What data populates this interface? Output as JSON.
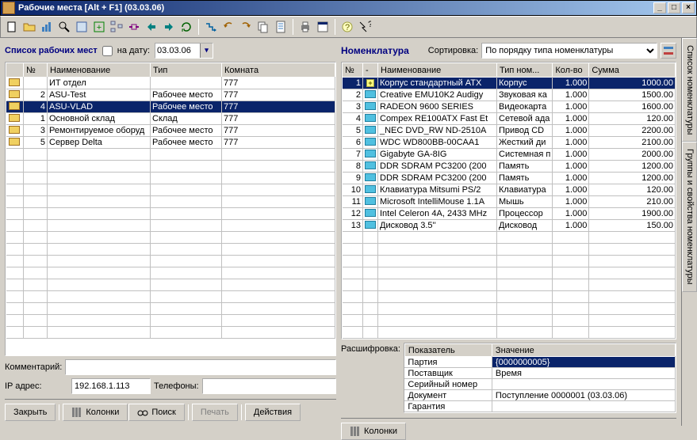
{
  "window": {
    "title": "Рабочие места [Alt + F1] (03.03.06)"
  },
  "left": {
    "heading": "Список рабочих мест",
    "date_label": "на дату:",
    "date_value": "03.03.06",
    "cols": {
      "num": "№",
      "name": "Наименование",
      "type": "Тип",
      "room": "Комната"
    },
    "rows": [
      {
        "num": "",
        "name": "ИТ отдел",
        "type": "",
        "room": "777",
        "selected": false
      },
      {
        "num": "2",
        "name": "ASU-Test",
        "type": "Рабочее место",
        "room": "777",
        "selected": false
      },
      {
        "num": "4",
        "name": "ASU-VLAD",
        "type": "Рабочее место",
        "room": "777",
        "selected": true
      },
      {
        "num": "1",
        "name": "Основной склад",
        "type": "Склад",
        "room": "777",
        "selected": false
      },
      {
        "num": "3",
        "name": "Ремонтируемое оборуд",
        "type": "Рабочее место",
        "room": "777",
        "selected": false
      },
      {
        "num": "5",
        "name": "Сервер Delta",
        "type": "Рабочее место",
        "room": "777",
        "selected": false
      }
    ],
    "comment_label": "Комментарий:",
    "comment_value": "",
    "ip_label": "IP адрес:",
    "ip_value": "192.168.1.113",
    "phones_label": "Телефоны:",
    "phones_value": "",
    "btn_close": "Закрыть",
    "btn_columns": "Колонки",
    "btn_search": "Поиск",
    "btn_print": "Печать",
    "btn_actions": "Действия"
  },
  "right": {
    "heading": "Номенклатура",
    "sort_label": "Сортировка:",
    "sort_value": "По порядку типа номенклатуры",
    "cols": {
      "num": "№",
      "dash": "-",
      "name": "Наименование",
      "type": "Тип ном...",
      "qty": "Кол-во",
      "sum": "Сумма"
    },
    "rows": [
      {
        "num": "1",
        "name": "Корпус стандартный ATX",
        "type": "Корпус",
        "qty": "1.000",
        "sum": "1000.00",
        "selected": true,
        "star": true
      },
      {
        "num": "2",
        "name": "Creative EMU10K2 Audigy",
        "type": "Звуковая ка",
        "qty": "1.000",
        "sum": "1500.00"
      },
      {
        "num": "3",
        "name": "RADEON 9600 SERIES",
        "type": "Видеокарта",
        "qty": "1.000",
        "sum": "1600.00"
      },
      {
        "num": "4",
        "name": "Compex RE100ATX Fast Et",
        "type": "Сетевой ада",
        "qty": "1.000",
        "sum": "120.00"
      },
      {
        "num": "5",
        "name": "_NEC DVD_RW ND-2510A",
        "type": "Привод CD",
        "qty": "1.000",
        "sum": "2200.00"
      },
      {
        "num": "6",
        "name": "WDC WD800BB-00CAA1",
        "type": "Жесткий ди",
        "qty": "1.000",
        "sum": "2100.00"
      },
      {
        "num": "7",
        "name": "Gigabyte GA-8IG",
        "type": "Системная п",
        "qty": "1.000",
        "sum": "2000.00"
      },
      {
        "num": "8",
        "name": "DDR SDRAM PC3200 (200",
        "type": "Память",
        "qty": "1.000",
        "sum": "1200.00"
      },
      {
        "num": "9",
        "name": "DDR SDRAM PC3200 (200",
        "type": "Память",
        "qty": "1.000",
        "sum": "1200.00"
      },
      {
        "num": "10",
        "name": "Клавиатура Mitsumi PS/2",
        "type": "Клавиатура",
        "qty": "1.000",
        "sum": "120.00"
      },
      {
        "num": "11",
        "name": "Microsoft IntelliMouse 1.1A",
        "type": "Мышь",
        "qty": "1.000",
        "sum": "210.00"
      },
      {
        "num": "12",
        "name": "Intel Celeron 4A, 2433 MHz",
        "type": "Процессор",
        "qty": "1.000",
        "sum": "1900.00"
      },
      {
        "num": "13",
        "name": "Дисковод 3.5''",
        "type": "Дисковод",
        "qty": "1.000",
        "sum": "150.00"
      }
    ],
    "detail_label": "Расшифровка:",
    "detail_cols": {
      "key": "Показатель",
      "val": "Значение"
    },
    "details": [
      {
        "key": "Партия",
        "val": "{0000000005}",
        "selected": true
      },
      {
        "key": "Поставщик",
        "val": "Время"
      },
      {
        "key": "Серийный номер",
        "val": ""
      },
      {
        "key": "Документ",
        "val": "Поступление 0000001 (03.03.06)"
      },
      {
        "key": "Гарантия",
        "val": ""
      }
    ],
    "btn_columns": "Колонки"
  },
  "sidetabs": {
    "tab1": "Список номенклатуры",
    "tab2": "Группы и свойства номенклатуры"
  }
}
